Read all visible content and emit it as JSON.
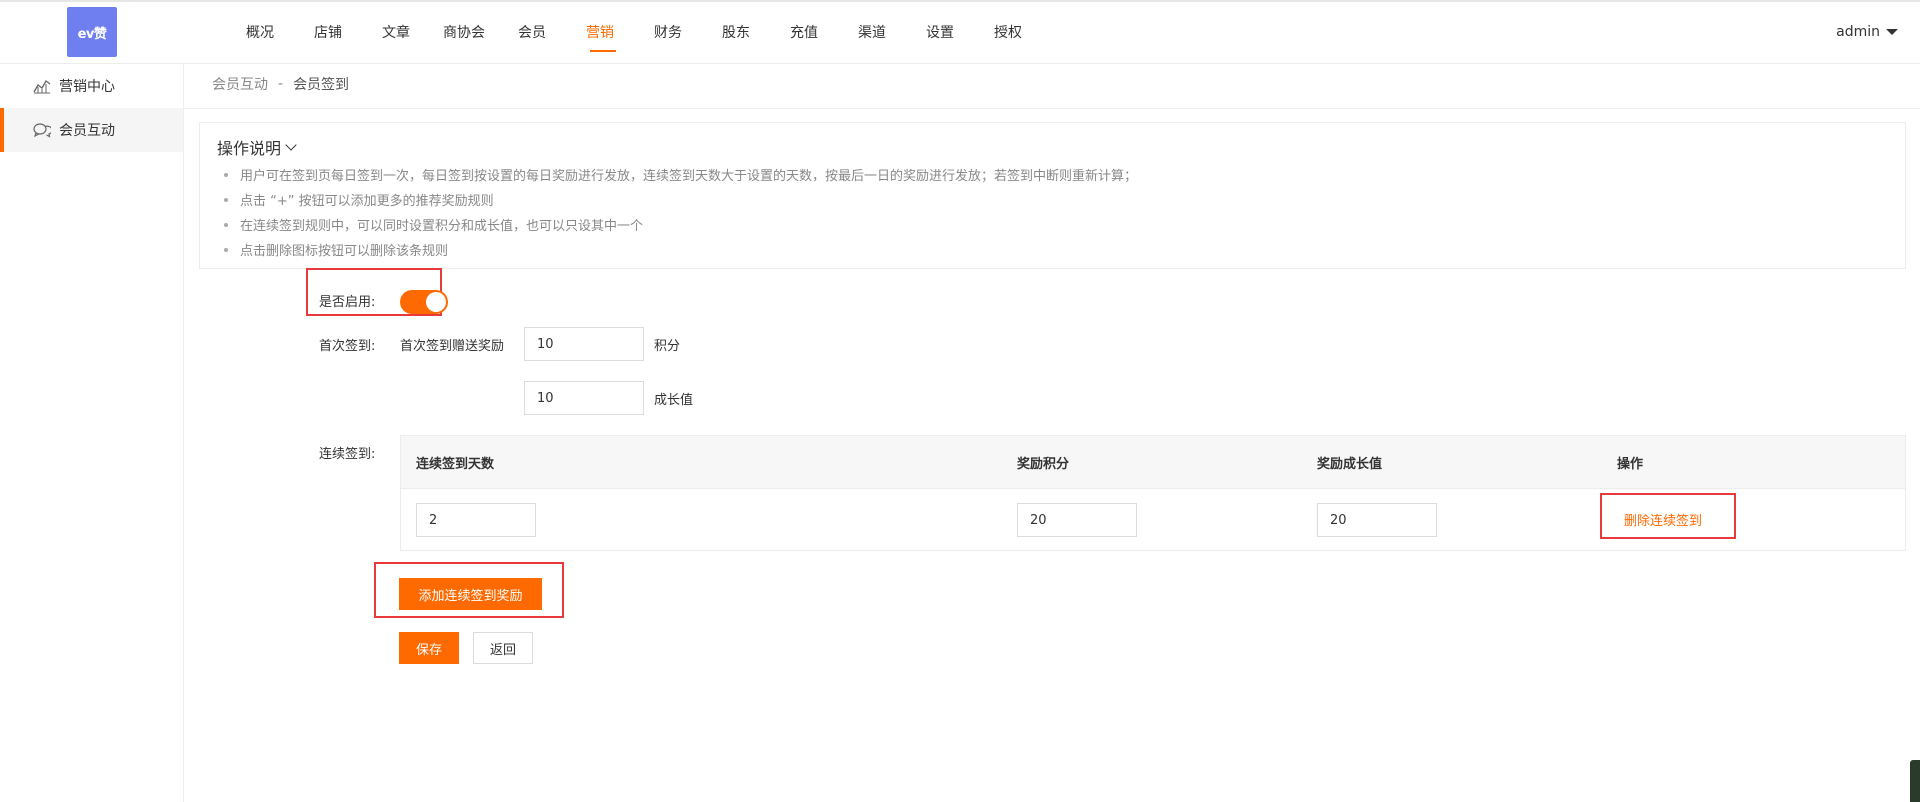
{
  "logo": {
    "text": "ev赞"
  },
  "nav": [
    {
      "label": "概况",
      "active": false
    },
    {
      "label": "店铺",
      "active": false
    },
    {
      "label": "文章",
      "active": false
    },
    {
      "label": "商协会",
      "active": false
    },
    {
      "label": "会员",
      "active": false
    },
    {
      "label": "营销",
      "active": true
    },
    {
      "label": "财务",
      "active": false
    },
    {
      "label": "股东",
      "active": false
    },
    {
      "label": "充值",
      "active": false
    },
    {
      "label": "渠道",
      "active": false
    },
    {
      "label": "设置",
      "active": false
    },
    {
      "label": "授权",
      "active": false
    }
  ],
  "user": {
    "name": "admin"
  },
  "sidebar": {
    "items": [
      {
        "label": "营销中心",
        "icon": "chart-icon",
        "active": false
      },
      {
        "label": "会员互动",
        "icon": "chat-icon",
        "active": true
      }
    ]
  },
  "breadcrumb": {
    "parent": "会员互动",
    "separator": "-",
    "current": "会员签到"
  },
  "instructions": {
    "title": "操作说明",
    "items": [
      "用户可在签到页每日签到一次，每日签到按设置的每日奖励进行发放，连续签到天数大于设置的天数，按最后一日的奖励进行发放；若签到中断则重新计算；",
      "点击 “+” 按钮可以添加更多的推荐奖励规则",
      "在连续签到规则中，可以同时设置积分和成长值，也可以只设其中一个",
      "点击删除图标按钮可以删除该条规则"
    ]
  },
  "form": {
    "enable_label": "是否启用:",
    "enabled": true,
    "first_label": "首次签到:",
    "first_reward_label": "首次签到赠送奖励",
    "first_points": "10",
    "points_unit": "积分",
    "first_growth": "10",
    "growth_unit": "成长值",
    "continuous_label": "连续签到:"
  },
  "table": {
    "headers": [
      "连续签到天数",
      "奖励积分",
      "奖励成长值",
      "操作"
    ],
    "rows": [
      {
        "days": "2",
        "points": "20",
        "growth": "20",
        "action": "删除连续签到"
      }
    ]
  },
  "buttons": {
    "add": "添加连续签到奖励",
    "save": "保存",
    "back": "返回"
  },
  "colors": {
    "accent": "#ff6a00",
    "highlight": "#e83a3a",
    "logo_bg": "#6f7ff0"
  }
}
